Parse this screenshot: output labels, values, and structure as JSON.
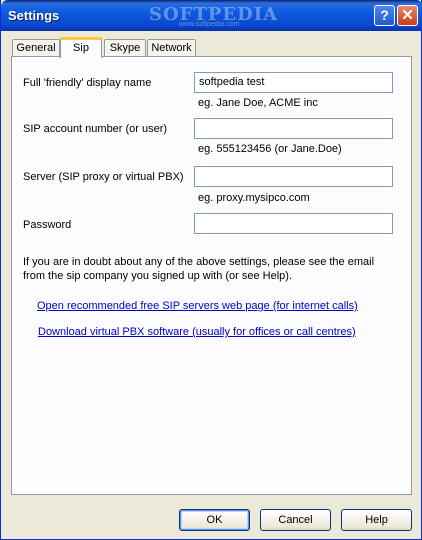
{
  "window": {
    "title": "Settings",
    "watermark": "SOFTPEDIA",
    "watermark_sub": "www.softpedia.com",
    "help_glyph": "?",
    "close_glyph": "✕"
  },
  "tabs": [
    "General",
    "Sip",
    "Skype",
    "Network"
  ],
  "active_tab": "Sip",
  "form": {
    "display_name_label": "Full 'friendly' display name",
    "display_name_value": "softpedia test",
    "display_name_hint": "eg. Jane Doe, ACME inc",
    "account_label": "SIP account number (or user)",
    "account_value": "",
    "account_hint": "eg.  555123456 (or Jane.Doe)",
    "server_label": "Server (SIP proxy or virtual PBX)",
    "server_value": "",
    "server_hint": "eg. proxy.mysipco.com",
    "password_label": "Password",
    "password_value": ""
  },
  "note": "If you are in doubt about any of the above settings, please see the email from the sip company you signed up with (or see Help).",
  "links": {
    "sip_servers": "Open recommended free SIP servers web page (for internet calls)",
    "pbx_software": "Download virtual PBX software (usually for offices or call centres)"
  },
  "buttons": {
    "ok": "OK",
    "cancel": "Cancel",
    "help": "Help"
  }
}
